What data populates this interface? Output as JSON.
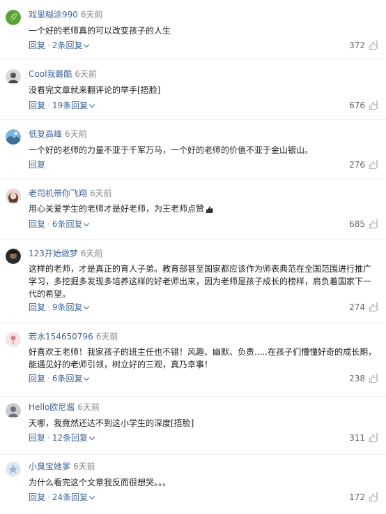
{
  "comments": [
    {
      "username": "戏里糊涂990",
      "time": "6天前",
      "content": "一个好的老师真的可以改变孩子的人生",
      "reply_label": "回复",
      "replies_label": "2条回复",
      "likes": "372",
      "avatar": "green-leaf"
    },
    {
      "username": "Cool我最酷",
      "time": "6天前",
      "content": "没看完文章就来翻评论的举手[捂脸]",
      "reply_label": "回复",
      "replies_label": "19条回复",
      "likes": "676",
      "avatar": "person-dark"
    },
    {
      "username": "低复高峰",
      "time": "6天前",
      "content": "一个好的老师的力量不亚于千军万马，一个好的老师的价值不亚于金山银山。",
      "reply_label": "回复",
      "replies_label": "",
      "likes": "276",
      "avatar": "landscape-blue"
    },
    {
      "username": "老司机带你飞翔",
      "time": "6天前",
      "content": "用心关爱学生的老师才是好老师，为王老师点赞",
      "reply_label": "回复",
      "replies_label": "6条回复",
      "likes": "685",
      "avatar": "girl-portrait"
    },
    {
      "username": "123开始做梦",
      "time": "6天前",
      "content": "这样的老师，才是真正的育人子弟。教育部甚至国家都应该作为师表典范在全国范围进行推广学习，多挖掘多发现多培养这样的好老师出来，因为老师是孩子成长的榜样，肩负着国家下一代的希望。",
      "reply_label": "回复",
      "replies_label": "9条回复",
      "likes": "274",
      "avatar": "dark-portrait"
    },
    {
      "username": "若水154650796",
      "time": "6天前",
      "content": "好喜欢王老师！我家孩子的班主任也不错！风趣、幽默、负责.....在孩子们懵懂好奇的成长期，能遇见好的老师引领，树立好的三观，真乃幸事！",
      "reply_label": "回复",
      "replies_label": "6条回复",
      "likes": "238",
      "avatar": "pink-flower"
    },
    {
      "username": "Hello欧尼酱",
      "time": "6天前",
      "content": "天哪，我竟然还达不到这小学生的深度[捂脸]",
      "reply_label": "回复",
      "replies_label": "12条回复",
      "likes": "311",
      "avatar": "gray-person"
    },
    {
      "username": "小臭宝她爹",
      "time": "6天前",
      "content": "为什么看完这个文章我反而很想哭。。。",
      "reply_label": "回复",
      "replies_label": "24条回复",
      "likes": "172",
      "avatar": "blue-star"
    }
  ],
  "colors": {
    "username": "#406599",
    "time": "#888888",
    "content": "#222222",
    "divider": "#ececec"
  }
}
